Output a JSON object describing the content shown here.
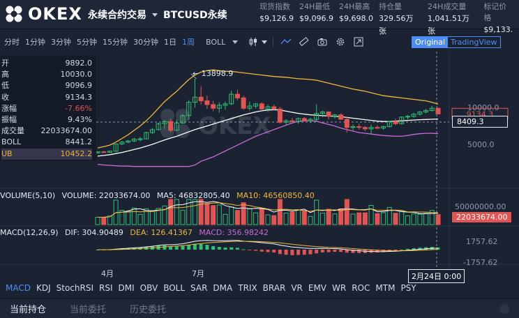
{
  "header": {
    "brand": "OKEX",
    "contract": "永续合约交易",
    "pair": "BTCUSD永续",
    "stats": [
      {
        "label": "现货指数",
        "value": "$9,126.9"
      },
      {
        "label": "24H最低",
        "value": "$9,096.9"
      },
      {
        "label": "24H最高",
        "value": "$9,698.0"
      },
      {
        "label": "持仓量",
        "value": "329.56万 张"
      },
      {
        "label": "24H成交量",
        "value": "1,041.51万 张"
      },
      {
        "label": "标记价格",
        "value": "$9,133."
      }
    ]
  },
  "toolbar": {
    "timeframes": [
      "分时",
      "1分钟",
      "3分钟",
      "5分钟",
      "15分钟",
      "30分钟",
      "1日",
      "1周"
    ],
    "active_timeframe": "1周",
    "indicator": "BOLL",
    "views": [
      "Original",
      "TradingView"
    ],
    "active_view": "Original"
  },
  "ohlc": [
    {
      "label": "开",
      "value": "9892.0"
    },
    {
      "label": "高",
      "value": "10030.0"
    },
    {
      "label": "低",
      "value": "9096.9"
    },
    {
      "label": "收",
      "value": "9134.3"
    },
    {
      "label": "涨幅",
      "value": "-7.66%"
    },
    {
      "label": "振幅",
      "value": "9.43%"
    },
    {
      "label": "成交量",
      "value": "22033674.00"
    },
    {
      "label": "BOLL",
      "value": "8441.2"
    },
    {
      "label": "UB",
      "value": "10452.2"
    }
  ],
  "axis": {
    "price_ticks": [
      "10000.0",
      "5000.0"
    ],
    "volume_tick": "50000000.00",
    "macd_ticks": [
      "1757.62",
      "-1757.62"
    ],
    "x_ticks": [
      "4月",
      "7月"
    ],
    "cursor_date": "2月24日 0:00"
  },
  "annotations": {
    "high_marker": "13898.9",
    "cursor_price": "8409.3",
    "last_price": "9134.3",
    "last_volume": "22033674.00"
  },
  "volume_line": {
    "name": "VOLUME(5,10)",
    "volume": "VOLUME: 22033674.00",
    "ma5": "MA5: 46832805.40",
    "ma10": "MA10: 46560850.40"
  },
  "macd_line": {
    "name": "MACD(12,26,9)",
    "dif": "DIF: 304.90489",
    "dea": "DEA: 126.41367",
    "macd": "MACD: 356.98242"
  },
  "indicator_tabs": [
    "MACD",
    "KDJ",
    "StochRSI",
    "RSI",
    "DMI",
    "OBV",
    "BOLL",
    "SAR",
    "DMA",
    "TRIX",
    "BRAR",
    "VR",
    "EMV",
    "WR",
    "ROC",
    "MTM",
    "PSY"
  ],
  "active_indicator_tab": "MACD",
  "bottom_tabs": [
    "当前持仓",
    "当前委托",
    "历史委托"
  ],
  "active_bottom_tab": "当前持仓",
  "colors": {
    "up": "#2fbf71",
    "down": "#e05454",
    "accent": "#4d8cf5",
    "boll_upper": "#f0b93b",
    "boll_mid": "#ffffff",
    "boll_lower": "#c96bd8"
  },
  "chart_data": {
    "type": "candlestick",
    "title": "",
    "candles": [
      {
        "o": 3850,
        "h": 4050,
        "l": 3750,
        "c": 3990
      },
      {
        "o": 3990,
        "h": 4100,
        "l": 3850,
        "c": 3920
      },
      {
        "o": 3920,
        "h": 4150,
        "l": 3880,
        "c": 4080
      },
      {
        "o": 4080,
        "h": 5100,
        "l": 4000,
        "c": 5050
      },
      {
        "o": 5050,
        "h": 5450,
        "l": 4900,
        "c": 5300
      },
      {
        "o": 5300,
        "h": 5600,
        "l": 5150,
        "c": 5450
      },
      {
        "o": 5450,
        "h": 5900,
        "l": 5300,
        "c": 5700
      },
      {
        "o": 5700,
        "h": 6000,
        "l": 5400,
        "c": 5750
      },
      {
        "o": 5750,
        "h": 6700,
        "l": 5700,
        "c": 6600
      },
      {
        "o": 6600,
        "h": 7200,
        "l": 6400,
        "c": 7000
      },
      {
        "o": 7000,
        "h": 7950,
        "l": 6900,
        "c": 7800
      },
      {
        "o": 7800,
        "h": 8300,
        "l": 7100,
        "c": 8100
      },
      {
        "o": 8100,
        "h": 8500,
        "l": 6600,
        "c": 6900
      },
      {
        "o": 6900,
        "h": 8400,
        "l": 6800,
        "c": 7900
      },
      {
        "o": 7900,
        "h": 9100,
        "l": 7800,
        "c": 8900
      },
      {
        "o": 8900,
        "h": 11000,
        "l": 8300,
        "c": 10700
      },
      {
        "o": 10700,
        "h": 13898.9,
        "l": 10000,
        "c": 11400
      },
      {
        "o": 11400,
        "h": 12900,
        "l": 10400,
        "c": 10900
      },
      {
        "o": 10900,
        "h": 11600,
        "l": 9800,
        "c": 10400
      },
      {
        "o": 10400,
        "h": 10900,
        "l": 9500,
        "c": 9900
      },
      {
        "o": 9900,
        "h": 10700,
        "l": 9300,
        "c": 10300
      },
      {
        "o": 10300,
        "h": 10800,
        "l": 9700,
        "c": 10500
      },
      {
        "o": 10500,
        "h": 12300,
        "l": 10300,
        "c": 11800
      },
      {
        "o": 11800,
        "h": 12400,
        "l": 11000,
        "c": 11300
      },
      {
        "o": 11300,
        "h": 11600,
        "l": 9700,
        "c": 9900
      },
      {
        "o": 9900,
        "h": 10800,
        "l": 9600,
        "c": 10200
      },
      {
        "o": 10200,
        "h": 10600,
        "l": 9900,
        "c": 10500
      },
      {
        "o": 10500,
        "h": 10700,
        "l": 9700,
        "c": 9800
      },
      {
        "o": 9800,
        "h": 10400,
        "l": 9400,
        "c": 10100
      },
      {
        "o": 10100,
        "h": 10400,
        "l": 9600,
        "c": 9800
      },
      {
        "o": 9800,
        "h": 10100,
        "l": 7800,
        "c": 8000
      },
      {
        "o": 8000,
        "h": 8400,
        "l": 7700,
        "c": 8200
      },
      {
        "o": 8200,
        "h": 8600,
        "l": 7900,
        "c": 8100
      },
      {
        "o": 8100,
        "h": 8600,
        "l": 7800,
        "c": 8500
      },
      {
        "o": 8500,
        "h": 8700,
        "l": 8100,
        "c": 8200
      },
      {
        "o": 8200,
        "h": 8600,
        "l": 7900,
        "c": 8400
      },
      {
        "o": 8400,
        "h": 10400,
        "l": 8200,
        "c": 9200
      },
      {
        "o": 9200,
        "h": 9600,
        "l": 8700,
        "c": 9400
      },
      {
        "o": 9400,
        "h": 9500,
        "l": 8400,
        "c": 8800
      },
      {
        "o": 8800,
        "h": 9100,
        "l": 8500,
        "c": 9000
      },
      {
        "o": 9000,
        "h": 9200,
        "l": 8300,
        "c": 8400
      },
      {
        "o": 8400,
        "h": 8700,
        "l": 6600,
        "c": 7300
      },
      {
        "o": 7300,
        "h": 7700,
        "l": 6900,
        "c": 7400
      },
      {
        "o": 7400,
        "h": 7800,
        "l": 7000,
        "c": 7300
      },
      {
        "o": 7300,
        "h": 7500,
        "l": 6800,
        "c": 7100
      },
      {
        "o": 7100,
        "h": 7700,
        "l": 6500,
        "c": 7300
      },
      {
        "o": 7300,
        "h": 7600,
        "l": 7100,
        "c": 7200
      },
      {
        "o": 7200,
        "h": 7500,
        "l": 7000,
        "c": 7400
      },
      {
        "o": 7400,
        "h": 8200,
        "l": 7300,
        "c": 8100
      },
      {
        "o": 8100,
        "h": 8500,
        "l": 7600,
        "c": 7800
      },
      {
        "o": 7800,
        "h": 8800,
        "l": 7700,
        "c": 8700
      },
      {
        "o": 8700,
        "h": 9000,
        "l": 8400,
        "c": 8800
      },
      {
        "o": 8800,
        "h": 9300,
        "l": 8600,
        "c": 9100
      },
      {
        "o": 9100,
        "h": 9500,
        "l": 8900,
        "c": 9400
      },
      {
        "o": 9400,
        "h": 9800,
        "l": 9200,
        "c": 9600
      },
      {
        "o": 9600,
        "h": 10200,
        "l": 9400,
        "c": 9900
      },
      {
        "o": 9892,
        "h": 10030,
        "l": 9096.9,
        "c": 9134.3
      }
    ],
    "boll_upper": [
      4500,
      4700,
      4900,
      5300,
      5800,
      6300,
      6900,
      7500,
      8200,
      9000,
      9900,
      10800,
      11500,
      12200,
      13000,
      13800,
      14400,
      14800,
      15000,
      15100,
      15000,
      14900,
      14900,
      14800,
      14700,
      14600,
      14500,
      14400,
      14300,
      14200,
      14150,
      14100,
      14000,
      13900,
      13850,
      13800,
      13700,
      13500,
      13300,
      13100,
      12900,
      12700,
      12500,
      12350,
      12200,
      12000,
      11800,
      11600,
      11500,
      11400,
      11300,
      11200,
      11100,
      11000,
      10900,
      10700,
      10452.2
    ],
    "boll_mid": [
      3400,
      3500,
      3600,
      3750,
      3900,
      4100,
      4300,
      4500,
      4750,
      5000,
      5300,
      5600,
      5850,
      6100,
      6400,
      6700,
      7000,
      7250,
      7500,
      7750,
      8000,
      8250,
      8500,
      8750,
      9000,
      9200,
      9400,
      9550,
      9650,
      9700,
      9650,
      9500,
      9350,
      9200,
      9100,
      9000,
      8950,
      8900,
      8850,
      8800,
      8750,
      8650,
      8550,
      8450,
      8350,
      8250,
      8150,
      8100,
      8100,
      8150,
      8200,
      8250,
      8300,
      8350,
      8380,
      8410,
      8441.2
    ],
    "boll_lower": [
      2300,
      2200,
      2150,
      2100,
      2050,
      2050,
      2000,
      2000,
      2000,
      2000,
      2000,
      2000,
      2000,
      2000,
      2000,
      2000,
      2200,
      2700,
      3000,
      3300,
      3700,
      4100,
      4500,
      4900,
      5300,
      5700,
      6100,
      6400,
      6700,
      7000,
      7300,
      7600,
      7900,
      8100,
      8200,
      8200,
      8150,
      7900,
      7700,
      7500,
      7200,
      7000,
      6800,
      6600,
      6500,
      6400,
      6300,
      6200,
      6150,
      6100,
      6100,
      6200,
      6350,
      6450,
      6500,
      6500,
      6450
    ]
  }
}
